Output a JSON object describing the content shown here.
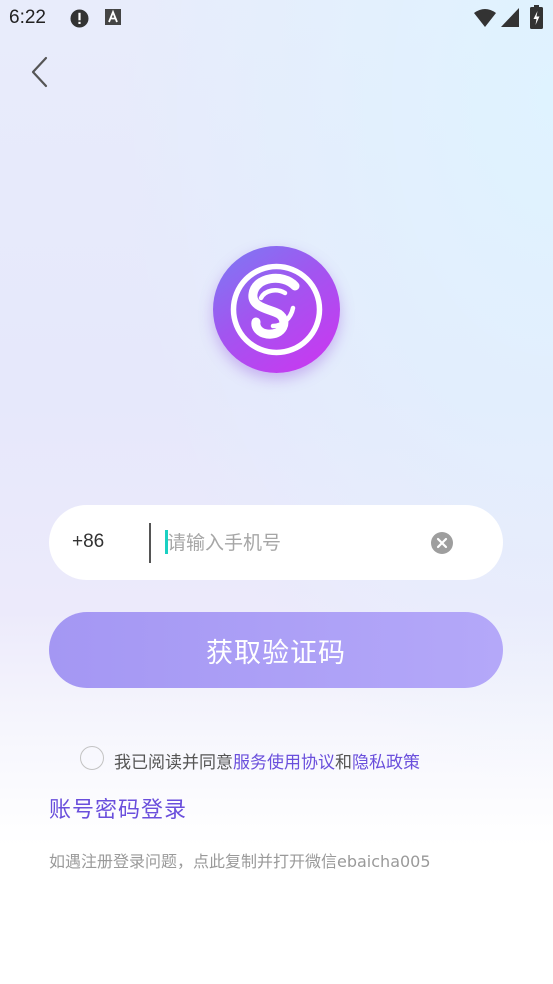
{
  "status_bar": {
    "time": "6:22",
    "icons": [
      "alert-icon",
      "a-icon",
      "wifi-icon",
      "signal-icon",
      "battery-icon"
    ]
  },
  "nav": {
    "back_icon": "chevron-left-icon"
  },
  "logo": {
    "icon": "s-logo-icon",
    "colors": [
      "#7a7cf3",
      "#cf34f0"
    ]
  },
  "phone": {
    "country_code": "+86",
    "placeholder": "请输入手机号",
    "value": "",
    "clear_icon": "clear-icon"
  },
  "get_code_button": {
    "label": "获取验证码"
  },
  "agreement": {
    "prefix": "我已阅读并同意",
    "terms_link": "服务使用协议",
    "and": "和",
    "privacy_link": "隐私政策",
    "checked": false
  },
  "password_login": {
    "label": "账号密码登录"
  },
  "help": {
    "text": "如遇注册登录问题，点此复制并打开微信ebaicha005"
  },
  "colors": {
    "accent": "#6a4fdc",
    "button": "#a99cf5",
    "cursor": "#1ad0c2"
  }
}
